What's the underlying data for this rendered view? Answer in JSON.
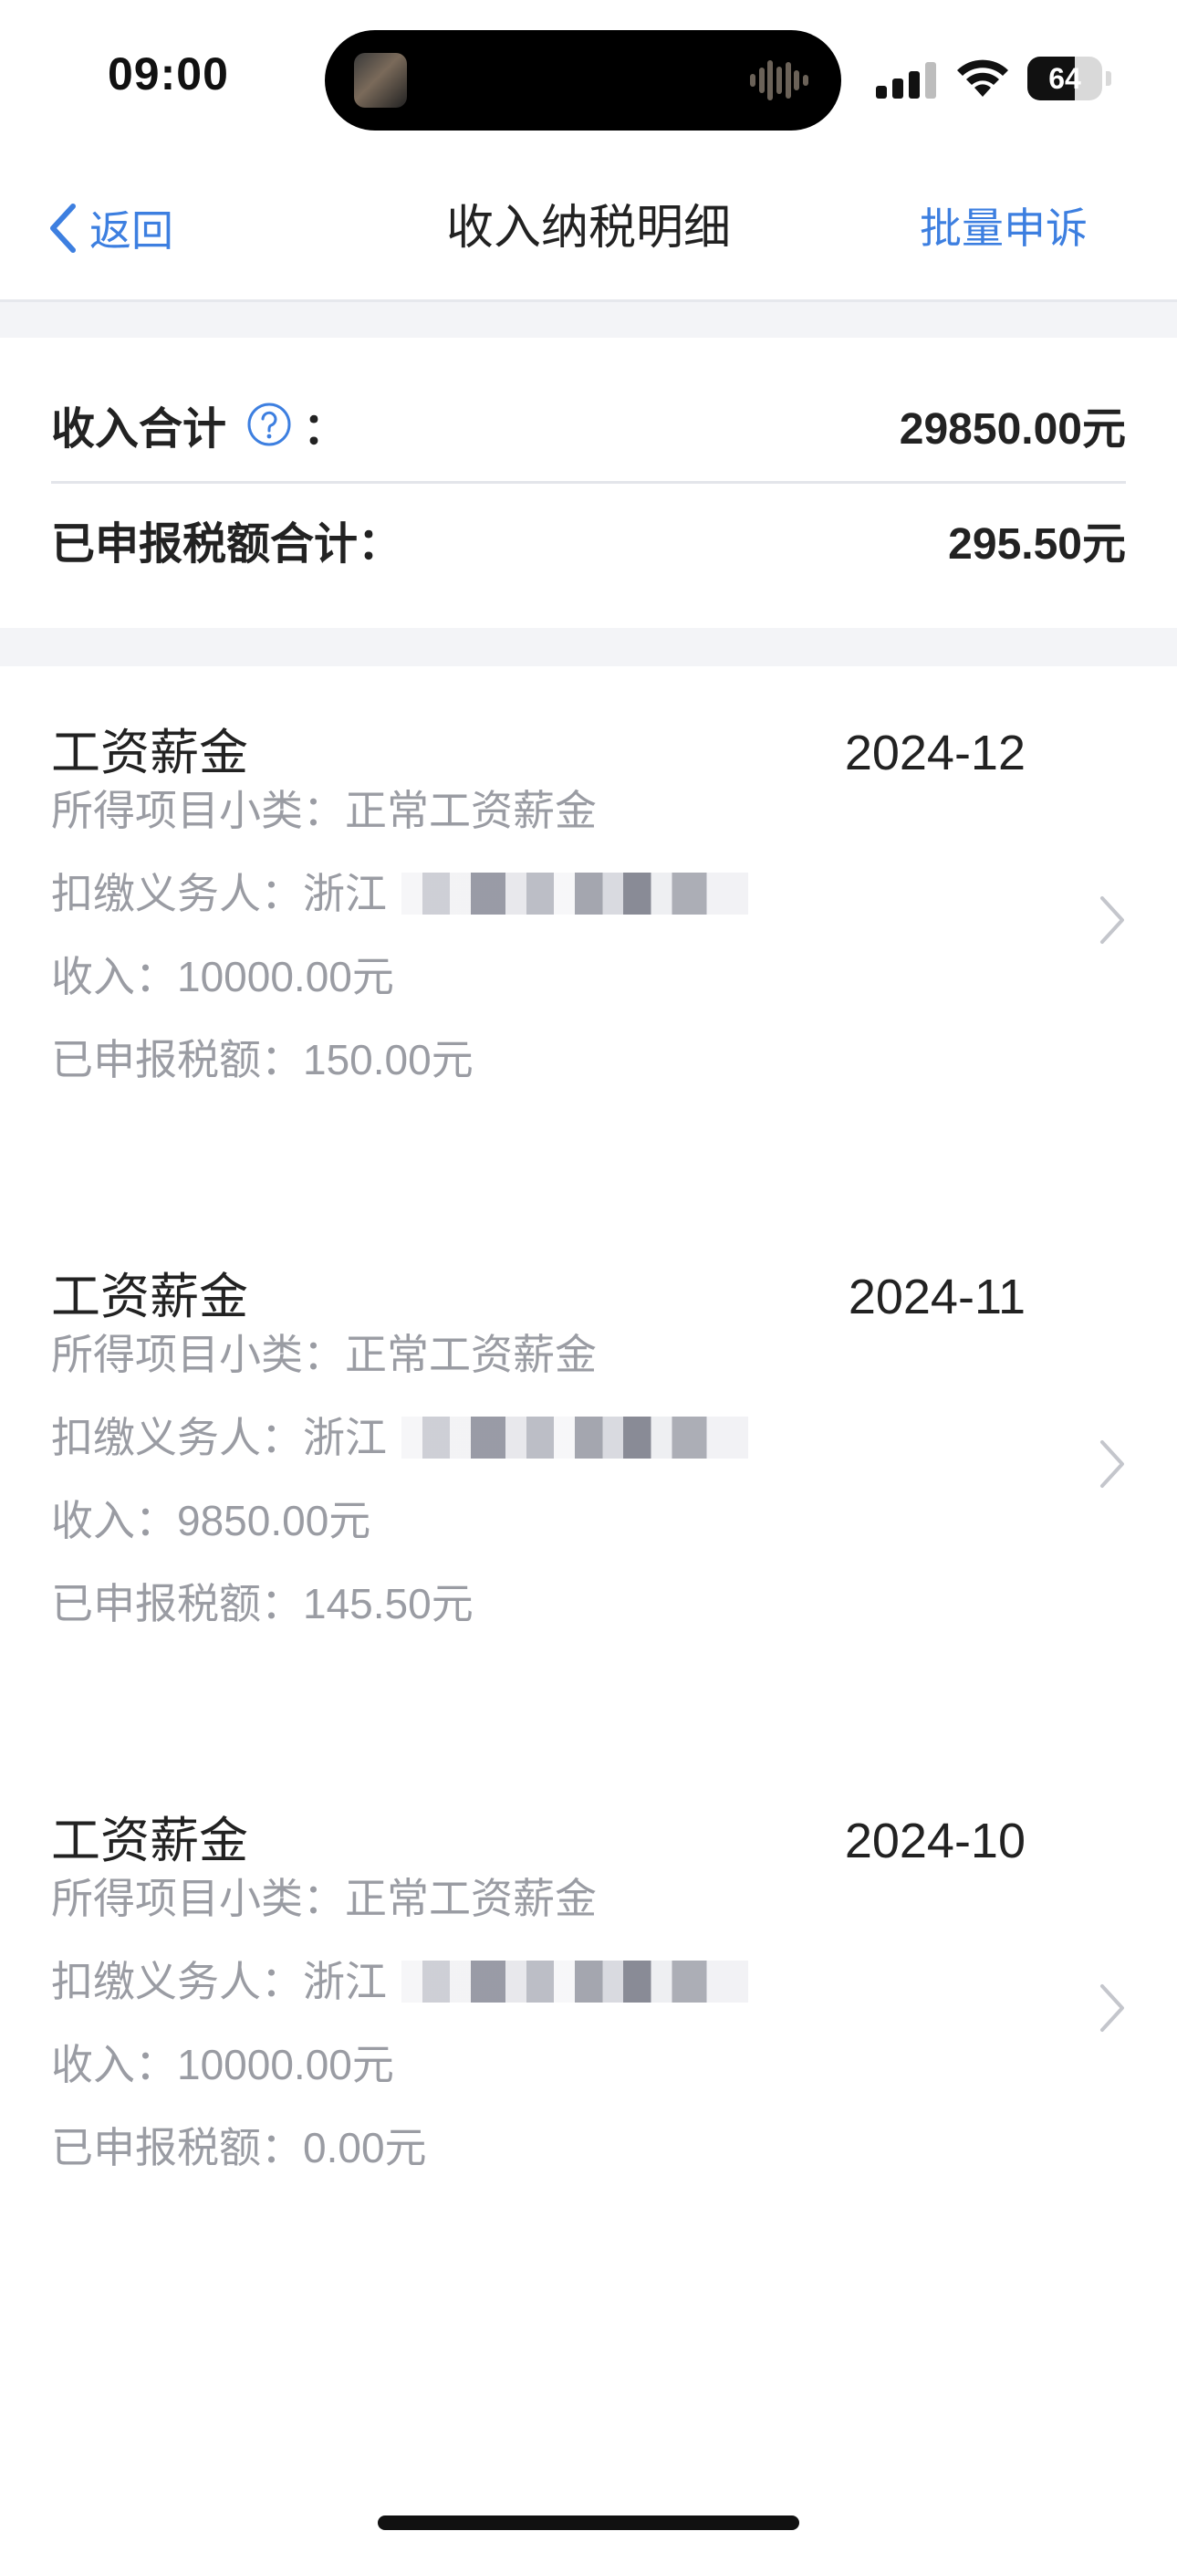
{
  "status_bar": {
    "time": "09:00",
    "battery": "64",
    "battery_level_percent": 64
  },
  "nav": {
    "back_label": "返回",
    "title": "收入纳税明细",
    "action_label": "批量申诉"
  },
  "summary": {
    "income_label": "收入合计",
    "income_colon": "：",
    "income_value": "29850.00元",
    "tax_label": "已申报税额合计：",
    "tax_value": "295.50元"
  },
  "records": [
    {
      "title": "工资薪金",
      "period": "2024-12",
      "subcategory": "所得项目小类：正常工资薪金",
      "withholder": "扣缴义务人：浙江",
      "income": "收入：10000.00元",
      "tax": "已申报税额：150.00元"
    },
    {
      "title": "工资薪金",
      "period": "2024-11",
      "subcategory": "所得项目小类：正常工资薪金",
      "withholder": "扣缴义务人：浙江",
      "income": "收入：9850.00元",
      "tax": "已申报税额：145.50元"
    },
    {
      "title": "工资薪金",
      "period": "2024-10",
      "subcategory": "所得项目小类：正常工资薪金",
      "withholder": "扣缴义务人：浙江",
      "income": "收入：10000.00元",
      "tax": "已申报税额：0.00元"
    }
  ],
  "colors": {
    "accent": "#3d7fe0",
    "text_primary": "#222222",
    "text_secondary": "#9a9ca3",
    "separator": "#f3f4f7"
  },
  "icons": {
    "back": "chevron-left-icon",
    "help": "question-circle-icon",
    "row_arrow": "chevron-right-icon"
  }
}
